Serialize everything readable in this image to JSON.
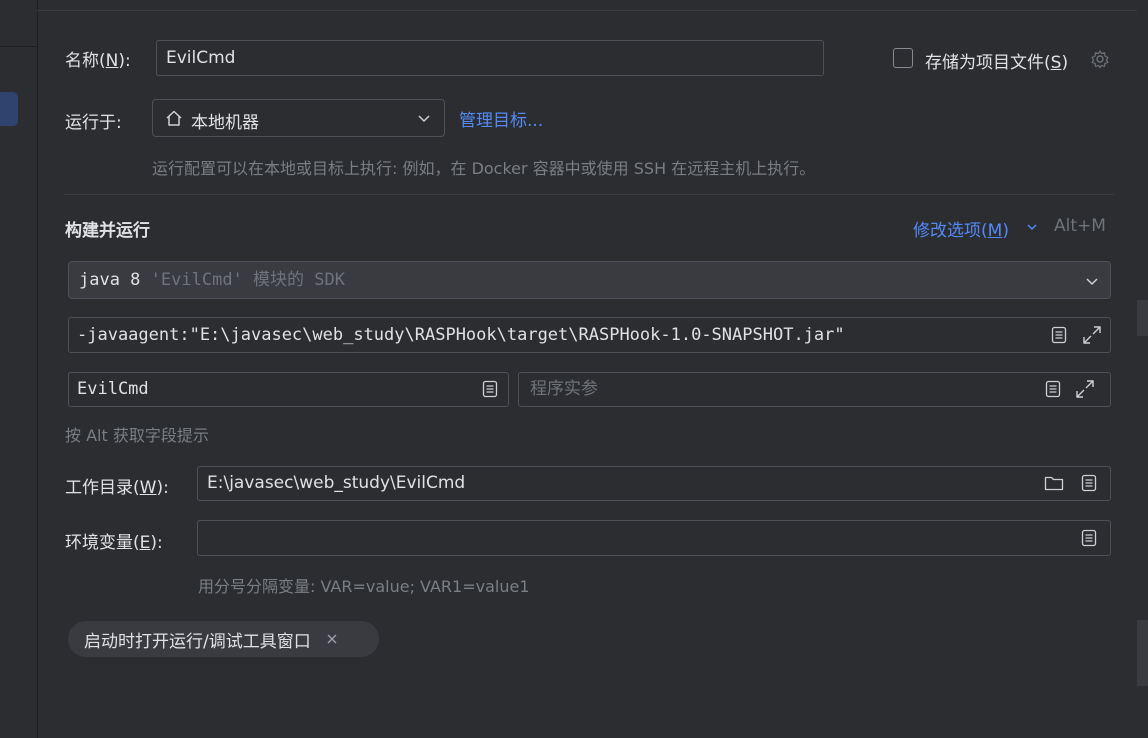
{
  "name_field": {
    "label": "名称(",
    "mnemonic": "N",
    "label_end": "):",
    "value": "EvilCmd"
  },
  "store_option": {
    "label": "存储为项目文件(",
    "mnemonic": "S",
    "label_end": ")",
    "checked": false
  },
  "run_on": {
    "label": "运行于:",
    "selected": "本地机器",
    "manage_link": "管理目标...",
    "hint": "运行配置可以在本地或目标上执行: 例如，在 Docker 容器中或使用 SSH 在远程主机上执行。"
  },
  "build_run": {
    "title": "构建并运行",
    "modify_options": {
      "label": "修改选项(",
      "mnemonic": "M",
      "label_end": ")",
      "shortcut": "Alt+M"
    },
    "sdk": {
      "java": "java 8",
      "detail": "'EvilCmd' 模块的 SDK"
    },
    "vm_options": "-javaagent:\"E:\\javasec\\web_study\\RASPHook\\target\\RASPHook-1.0-SNAPSHOT.jar\"",
    "main_class": "EvilCmd",
    "program_args_placeholder": "程序实参",
    "alt_hint": "按 Alt 获取字段提示"
  },
  "working_dir": {
    "label": "工作目录(",
    "mnemonic": "W",
    "label_end": "):",
    "value": "E:\\javasec\\web_study\\EvilCmd"
  },
  "env_vars": {
    "label": "环境变量(",
    "mnemonic": "E",
    "label_end": "):",
    "value": "",
    "hint": "用分号分隔变量: VAR=value; VAR1=value1"
  },
  "chip": {
    "label": "启动时打开运行/调试工具窗口"
  },
  "colors": {
    "accent": "#548af7",
    "background": "#2b2d30",
    "border": "#4e5157",
    "muted": "#6f737a"
  },
  "icons": [
    "gear-icon",
    "home-icon",
    "chevron-down-icon",
    "document-icon",
    "expand-icon",
    "folder-icon",
    "close-icon"
  ]
}
